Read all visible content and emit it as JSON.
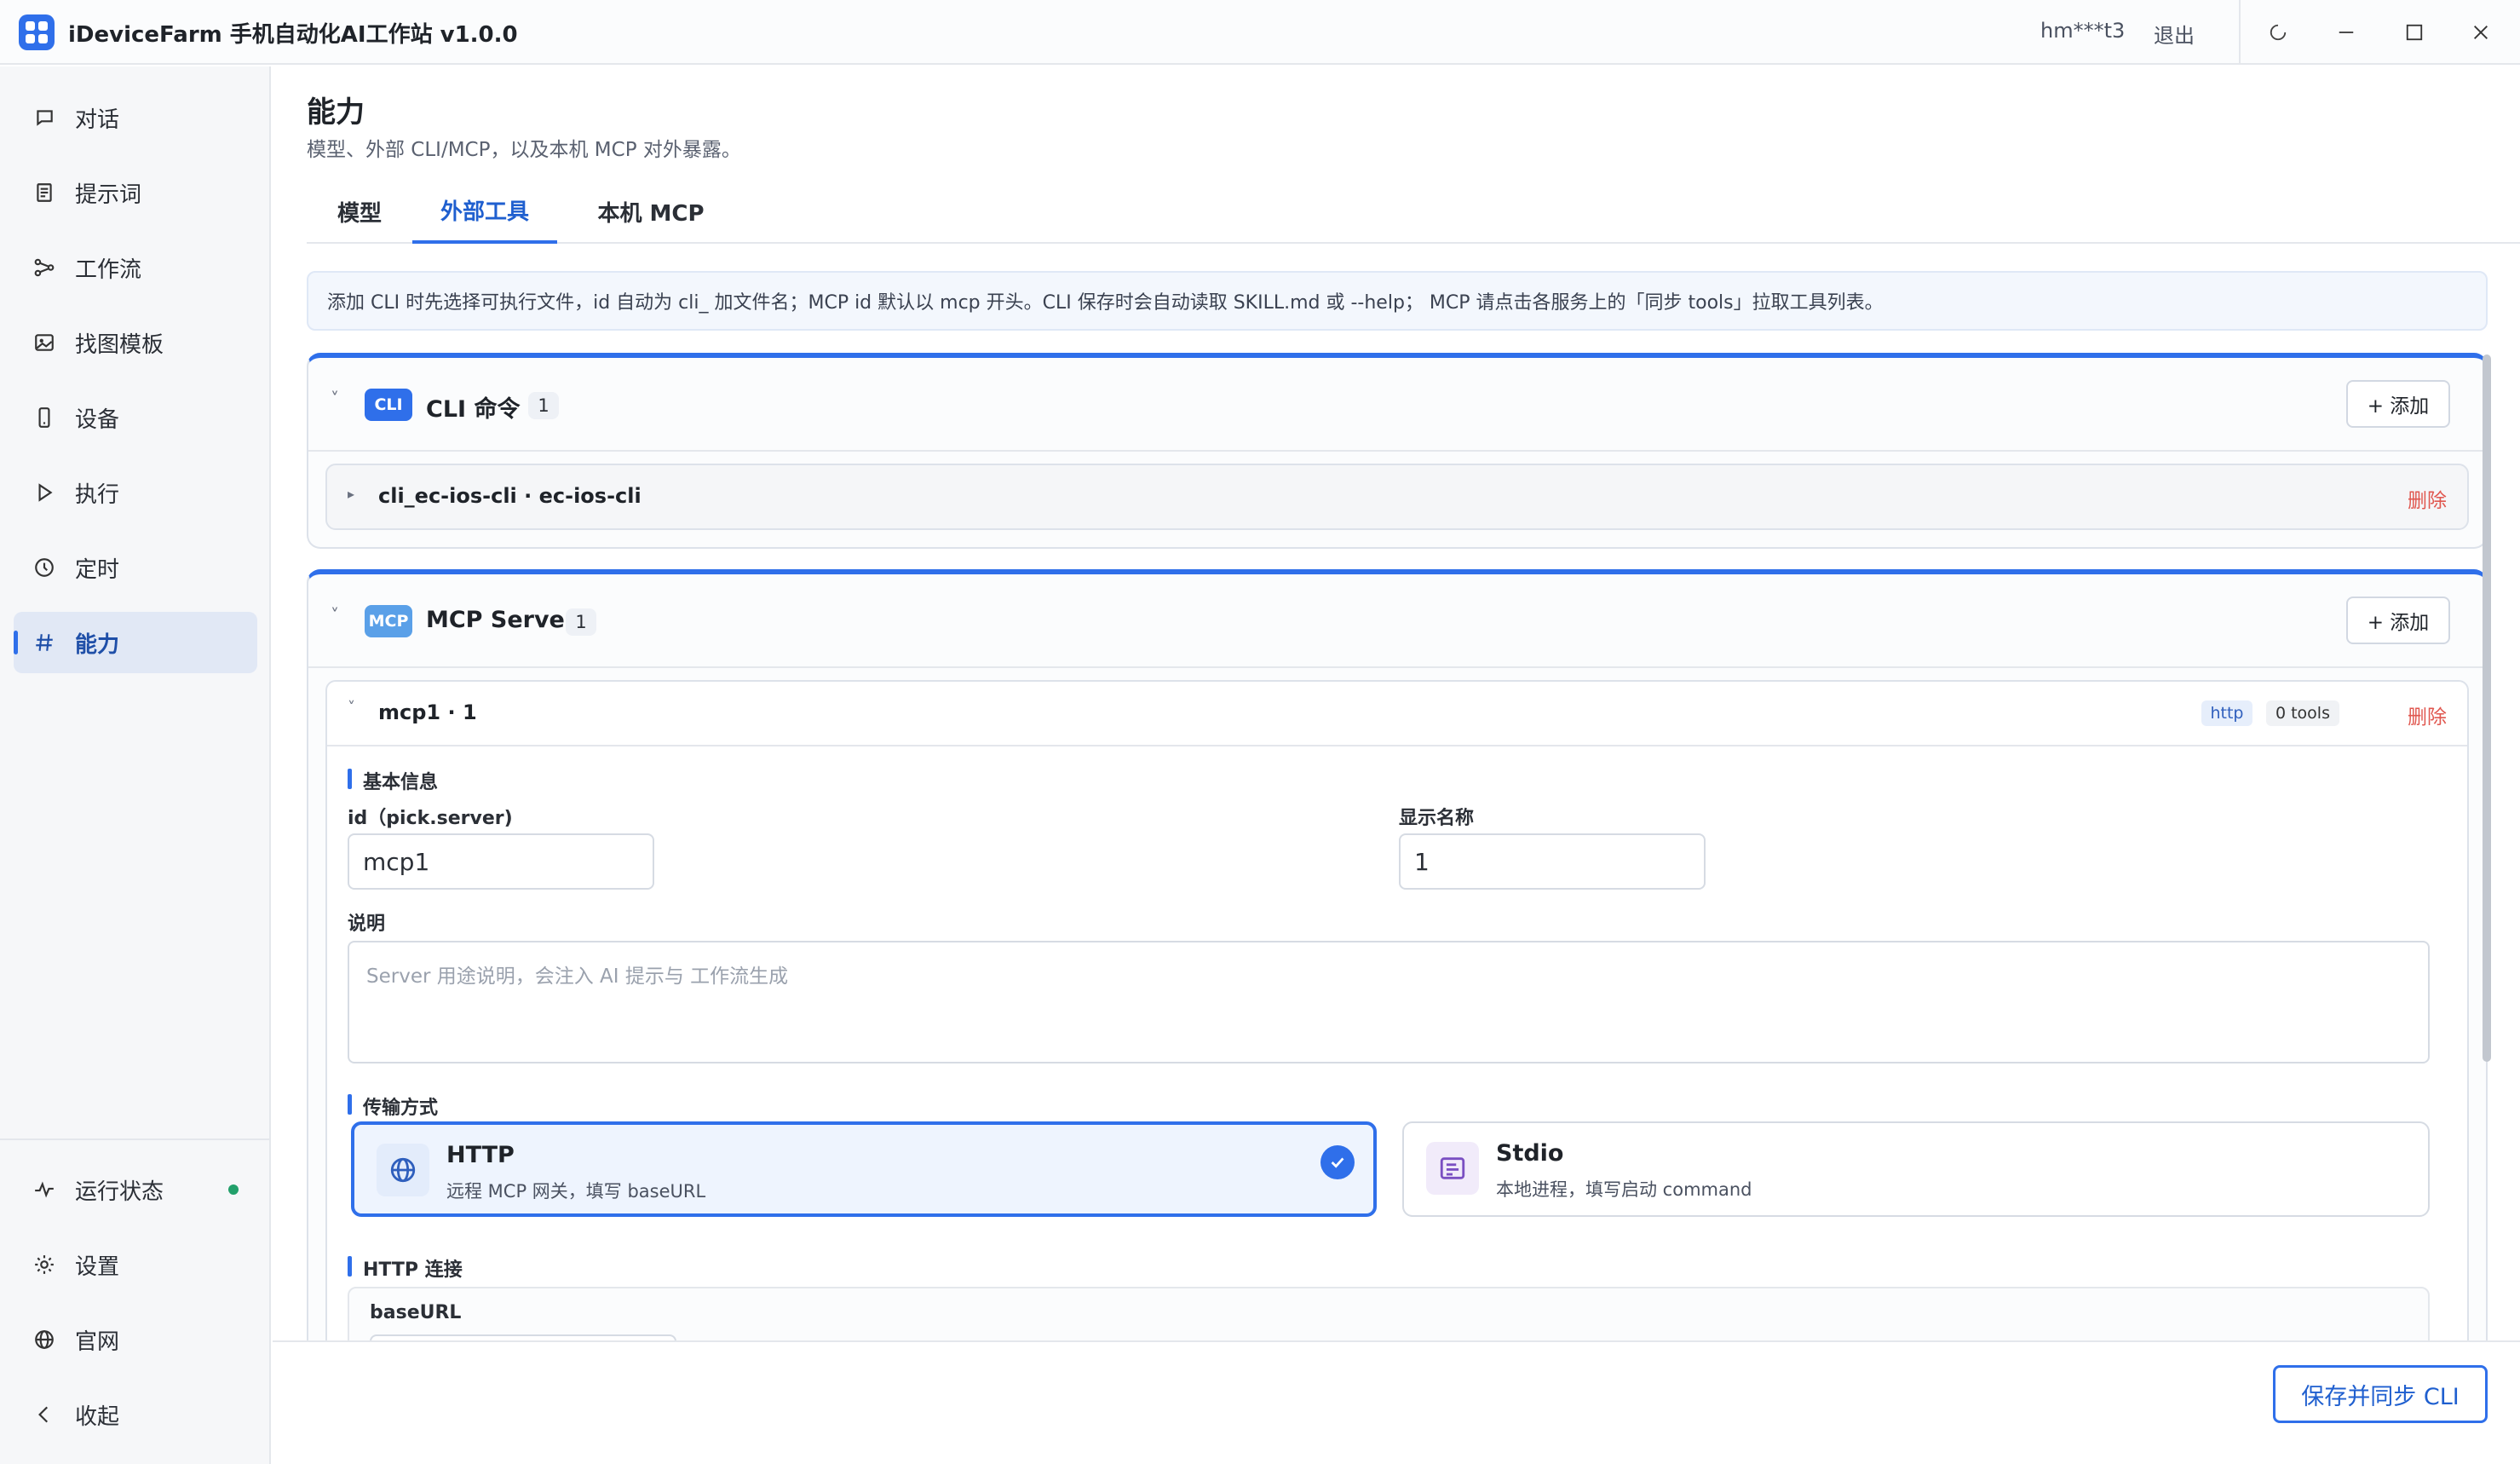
{
  "app": {
    "title": "iDeviceFarm 手机自动化AI工作站 v1.0.0",
    "user": "hm***t3",
    "logout": "退出"
  },
  "sidebar": {
    "items": [
      {
        "label": "对话",
        "icon": "chat-icon"
      },
      {
        "label": "提示词",
        "icon": "document-icon"
      },
      {
        "label": "工作流",
        "icon": "workflow-icon"
      },
      {
        "label": "找图模板",
        "icon": "image-icon"
      },
      {
        "label": "设备",
        "icon": "phone-icon"
      },
      {
        "label": "执行",
        "icon": "play-icon"
      },
      {
        "label": "定时",
        "icon": "clock-icon"
      },
      {
        "label": "能力",
        "icon": "hash-icon",
        "active": true
      }
    ],
    "bottom": [
      {
        "label": "运行状态",
        "icon": "pulse-icon"
      },
      {
        "label": "设置",
        "icon": "gear-icon"
      },
      {
        "label": "官网",
        "icon": "globe-icon"
      },
      {
        "label": "收起",
        "icon": "chevron-left-icon"
      }
    ]
  },
  "page": {
    "title": "能力",
    "subtitle": "模型、外部 CLI/MCP，以及本机 MCP 对外暴露。",
    "tabs": [
      "模型",
      "外部工具",
      "本机 MCP"
    ],
    "active_tab": "外部工具"
  },
  "banner": "添加 CLI 时先选择可执行文件，id 自动为 cli_ 加文件名；MCP id 默认以 mcp 开头。CLI 保存时会自动读取 SKILL.md 或 --help； MCP 请点击各服务上的「同步 tools」拉取工具列表。",
  "cli_section": {
    "badge": "CLI",
    "title": "CLI 命令",
    "count": "1",
    "add_label": "+ 添加",
    "items": [
      {
        "label": "cli_ec-ios-cli · ec-ios-cli",
        "delete": "删除"
      }
    ]
  },
  "mcp_section": {
    "badge": "MCP",
    "title": "MCP Server",
    "count": "1",
    "add_label": "+ 添加",
    "server": {
      "label": "mcp1 · 1",
      "transport_tag": "http",
      "tools_tag": "0 tools",
      "delete": "删除",
      "basic_info_label": "基本信息",
      "id_label": "id（pick.server)",
      "id_value": "mcp1",
      "display_name_label": "显示名称",
      "display_name_value": "1",
      "description_label": "说明",
      "description_placeholder": "Server 用途说明，会注入 AI 提示与 工作流生成",
      "transport_label": "传输方式",
      "transports": [
        {
          "title": "HTTP",
          "desc": "远程 MCP 网关，填写 baseURL",
          "selected": true
        },
        {
          "title": "Stdio",
          "desc": "本地进程，填写启动 command",
          "selected": false
        }
      ],
      "http_label": "HTTP 连接",
      "base_url_label": "baseURL"
    }
  },
  "footer": {
    "save_label": "保存并同步 CLI"
  },
  "colors": {
    "accent": "#2f6fea",
    "danger": "#e0574f",
    "status_ok": "#22a06b"
  }
}
